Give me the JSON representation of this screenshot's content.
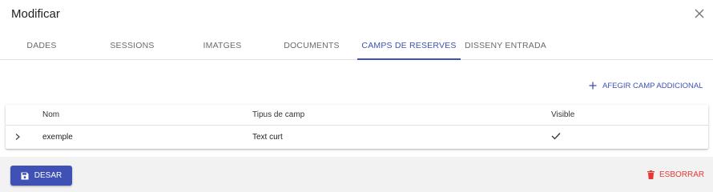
{
  "dialog": {
    "title": "Modificar"
  },
  "tabs": [
    {
      "label": "DADES",
      "active": false
    },
    {
      "label": "SESSIONS",
      "active": false
    },
    {
      "label": "IMATGES",
      "active": false
    },
    {
      "label": "DOCUMENTS",
      "active": false
    },
    {
      "label": "CAMPS DE RESERVES",
      "active": true
    },
    {
      "label": "DISSENY ENTRADA",
      "active": false
    }
  ],
  "toolbar": {
    "add_field_label": "AFEGIR CAMP ADDICIONAL"
  },
  "table": {
    "columns": [
      "Nom",
      "Tipus de camp",
      "Visible"
    ],
    "rows": [
      {
        "name": "exemple",
        "field_type": "Text curt",
        "visible": true
      }
    ]
  },
  "footer": {
    "save_label": "DESAR",
    "delete_label": "ESBORRAR"
  },
  "colors": {
    "accent": "#3f51b5",
    "danger": "#e53935",
    "footer_bg": "#f2f2f2"
  },
  "icons": {
    "close": "close-icon",
    "add": "plus-icon",
    "expand": "chevron-right-icon",
    "visible": "check-icon",
    "save": "floppy-disk-icon",
    "delete": "trash-icon"
  }
}
